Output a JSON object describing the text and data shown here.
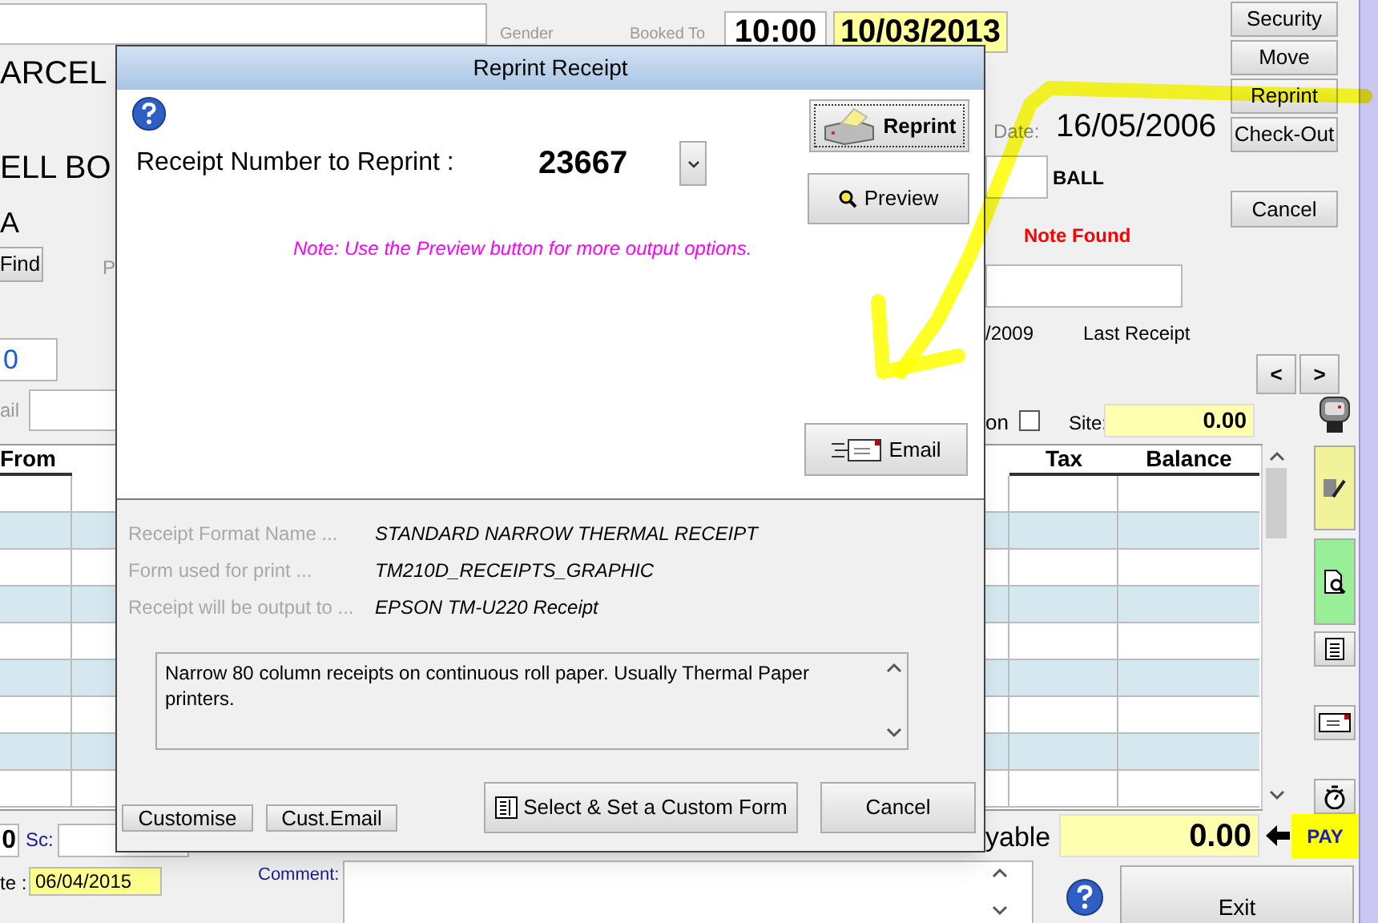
{
  "form": {
    "title_partial": "ARCEL",
    "name_partial": "ELL BO",
    "line_3": "A",
    "find_button": "Find",
    "label_p": "P",
    "field_value": "0",
    "label_ail": "ail",
    "gender_label": "Gender",
    "booked_to_label": "Booked To",
    "booked_time": "10:00",
    "booked_date": "10/03/2013",
    "side_buttons": [
      "Security",
      "Move",
      "Reprint",
      "Check-Out"
    ],
    "date_label": "Date:",
    "date_value": "16/05/2006",
    "surname": "BALL",
    "cancel_button": "Cancel",
    "note_status": "Note Found",
    "partial_date": "/2009",
    "last_receipt_label": "Last Receipt",
    "nav_buttons": [
      "<",
      ">"
    ],
    "option_label": "on",
    "option_checked": false,
    "site_label": "Site:",
    "site_value": "0.00",
    "table": {
      "columns": [
        "From",
        "Tax",
        "Balance"
      ]
    },
    "sc_value": "0",
    "sc_label": "Sc:",
    "date_label_2": "te :",
    "date_value_2": "06/04/2015",
    "comment_label": "Comment:",
    "payable_label": "yable",
    "payable_value": "0.00",
    "pay_button": "PAY",
    "exit_button": "Exit"
  },
  "dialog": {
    "title": "Reprint Receipt",
    "receipt_label": "Receipt Number to Reprint :",
    "receipt_number": "23667",
    "reprint_button": "Reprint",
    "preview_button": "Preview",
    "note": "Note: Use the Preview button for more output options.",
    "email_button": "Email",
    "details": [
      {
        "label": "Receipt Format Name ...",
        "value": "STANDARD NARROW THERMAL RECEIPT"
      },
      {
        "label": "Form used for print ...",
        "value": "TM210D_RECEIPTS_GRAPHIC"
      },
      {
        "label": "Receipt will be output to ...",
        "value": "EPSON TM-U220 Receipt"
      }
    ],
    "description": "Narrow 80 column receipts on continuous roll paper. Usually Thermal Paper printers.",
    "small_buttons": [
      "Customise",
      "Cust.Email"
    ],
    "custom_form_button": "Select & Set a Custom Form",
    "cancel_button": "Cancel"
  }
}
